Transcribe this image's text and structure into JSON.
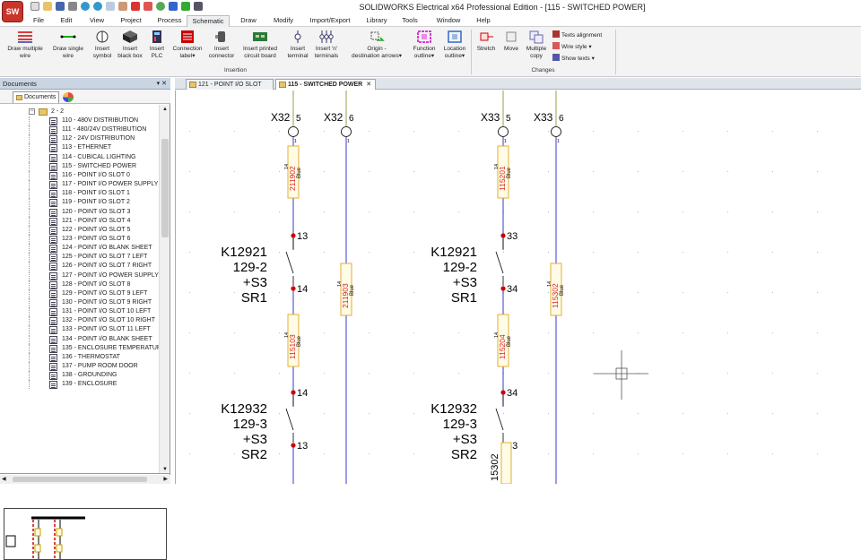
{
  "app": {
    "logo_text": "SW",
    "title": "SOLIDWORKS Electrical x64 Professional Edition - [115 - SWITCHED POWER]"
  },
  "menu": [
    "File",
    "Edit",
    "View",
    "Project",
    "Process",
    "Schematic",
    "Draw",
    "Modify",
    "Import/Export",
    "Library",
    "Tools",
    "Window",
    "Help"
  ],
  "active_menu": "Schematic",
  "ribbon": {
    "buttons": [
      {
        "l1": "Draw multiple",
        "l2": "wire"
      },
      {
        "l1": "Draw single",
        "l2": "wire"
      },
      {
        "l1": "Insert",
        "l2": "symbol"
      },
      {
        "l1": "Insert",
        "l2": "black box"
      },
      {
        "l1": "Insert",
        "l2": "PLC"
      },
      {
        "l1": "Connection",
        "l2": "label▾"
      },
      {
        "l1": "Insert",
        "l2": "connector"
      },
      {
        "l1": "Insert printed",
        "l2": "circuit board"
      },
      {
        "l1": "Insert",
        "l2": "terminal"
      },
      {
        "l1": "Insert 'n'",
        "l2": "terminals"
      },
      {
        "l1": "Origin -",
        "l2": "destination arrows▾"
      },
      {
        "l1": "Function",
        "l2": "outline▾"
      },
      {
        "l1": "Location",
        "l2": "outline▾"
      },
      {
        "l1": "Stretch",
        "l2": ""
      },
      {
        "l1": "Move",
        "l2": ""
      },
      {
        "l1": "Multiple",
        "l2": "copy"
      }
    ],
    "small_buttons": [
      "Texts alignment",
      "Wire style ▾",
      "Show texts ▾"
    ],
    "group_insertion": "Insertion",
    "group_changes": "Changes"
  },
  "documents_panel": {
    "title": "Documents",
    "pin": "▾ ✕",
    "tab_label": "Documents",
    "folder": "2 - 2",
    "items": [
      "110 - 480V DISTRIBUTION",
      "111 - 480/24V DISTRIBUTION",
      "112 - 24V DISTRIBUTION",
      "113 - ETHERNET",
      "114 - CUBICAL LIGHTING",
      "115 - SWITCHED POWER",
      "116 - POINT I/O SLOT 0",
      "117 - POINT I/O POWER SUPPLY",
      "118 - POINT I/O SLOT 1",
      "119 - POINT I/O SLOT 2",
      "120 - POINT I/O SLOT 3",
      "121 - POINT I/O SLOT 4",
      "122 - POINT I/O SLOT 5",
      "123 - POINT I/O SLOT 6",
      "124 - POINT I/O BLANK SHEET",
      "125 - POINT I/O SLOT 7 LEFT",
      "126 - POINT I/O SLOT 7 RIGHT",
      "127 - POINT I/O POWER SUPPLY",
      "128 - POINT I/O SLOT 8",
      "129 - POINT I/O SLOT 9 LEFT",
      "130 - POINT I/O SLOT 9 RIGHT",
      "131 - POINT I/O SLOT 10 LEFT",
      "132 - POINT I/O SLOT 10 RIGHT",
      "133 - POINT I/O SLOT 11 LEFT",
      "134 - POINT I/O BLANK SHEET",
      "135 - ENCLOSURE TEMPERATURE M",
      "136 - THERMOSTAT",
      "137 - PUMP ROOM DOOR",
      "138 - GROUNDING",
      "139 - ENCLOSURE"
    ]
  },
  "doc_tabs": [
    {
      "label": "121 - POINT I/O SLOT 4",
      "close": "✕"
    },
    {
      "label": "115 - SWITCHED POWER",
      "close": "✕"
    }
  ],
  "schematic": {
    "terminal_labels": [
      {
        "name": "X32",
        "num": "5"
      },
      {
        "name": "X32",
        "num": "6"
      },
      {
        "name": "X33",
        "num": "5"
      },
      {
        "name": "X33",
        "num": "6"
      }
    ],
    "sub_num": "1",
    "wires": [
      {
        "id": "211902",
        "spec": "14",
        "color": "Blue"
      },
      {
        "id": "211903",
        "spec": "14",
        "color": "Blue"
      },
      {
        "id": "115103",
        "spec": "14",
        "color": "Blue"
      },
      {
        "id": "115201",
        "spec": "14",
        "color": "Blue"
      },
      {
        "id": "115302",
        "spec": "14",
        "color": "Blue"
      },
      {
        "id": "115204",
        "spec": "14",
        "color": "Blue"
      }
    ],
    "components": [
      {
        "tag": "K12921",
        "ref": "129-2",
        "loc": "+S3",
        "func": "SR1"
      },
      {
        "tag": "K12932",
        "ref": "129-3",
        "loc": "+S3",
        "func": "SR2"
      },
      {
        "tag": "K12921",
        "ref": "129-2",
        "loc": "+S3",
        "func": "SR1"
      },
      {
        "tag": "K12932",
        "ref": "129-3",
        "loc": "+S3",
        "func": "SR2"
      }
    ],
    "pins": [
      "13",
      "14",
      "14",
      "13",
      "33",
      "34",
      "34",
      "33"
    ],
    "bottom_wire": "15302"
  }
}
